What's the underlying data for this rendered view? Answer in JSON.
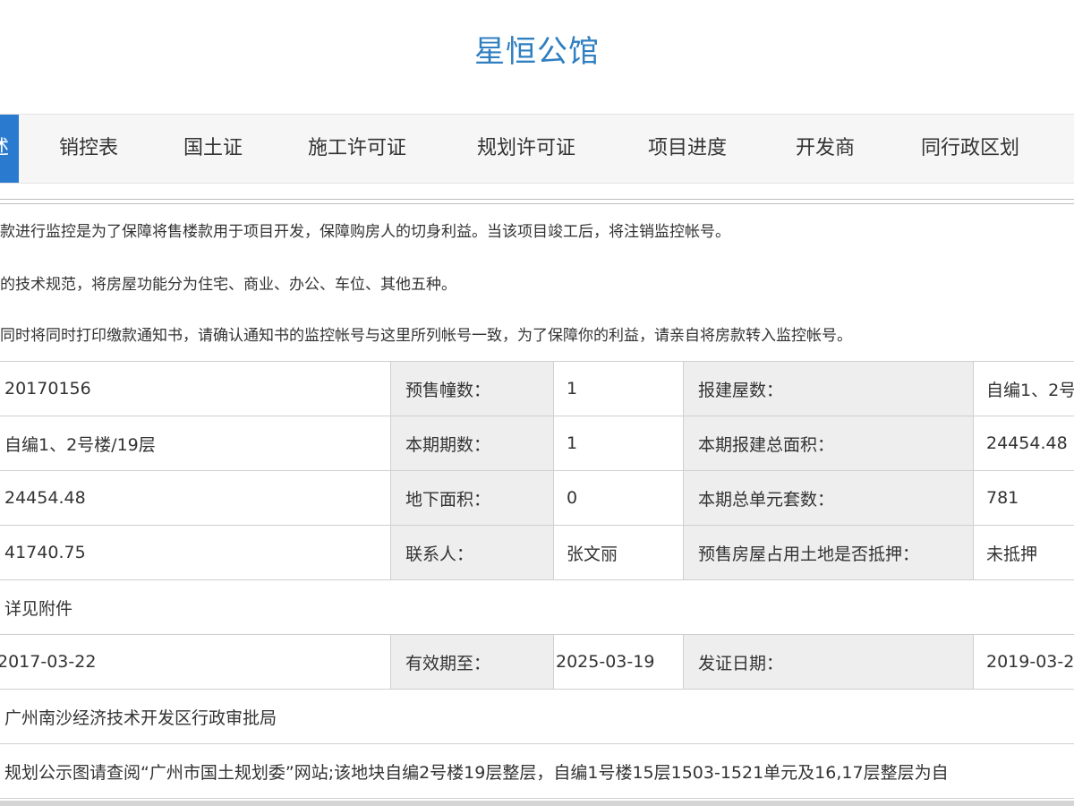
{
  "page_title": "星恒公馆",
  "tabs": {
    "active_partial": "述",
    "items": [
      "销控表",
      "国土证",
      "施工许可证",
      "规划许可证",
      "项目进度",
      "开发商",
      "同行政区划"
    ]
  },
  "notices": [
    "款进行监控是为了保障将售楼款用于项目开发，保障购房人的切身利益。当该项目竣工后，将注销监控帐号。",
    "的技术规范，将房屋功能分为住宅、商业、办公、车位、其他五种。",
    "同时将同时打印缴款通知书，请确认通知书的监控帐号与这里所列帐号一致，为了保障你的利益，请亲自将房款转入监控帐号。"
  ],
  "table": {
    "rows": [
      {
        "v1": "20170156",
        "l2": "预售幢数：",
        "v2": "1",
        "l3": "报建屋数：",
        "v3": "自编1、2号"
      },
      {
        "v1": "自编1、2号楼/19层",
        "l2": "本期期数：",
        "v2": "1",
        "l3": "本期报建总面积：",
        "v3": "24454.48"
      },
      {
        "v1": "24454.48",
        "l2": "地下面积：",
        "v2": "0",
        "l3": "本期总单元套数：",
        "v3": "781"
      },
      {
        "v1": "41740.75",
        "l2": "联系人：",
        "v2": "张文丽",
        "l3": "预售房屋占用土地是否抵押：",
        "v3": "未抵押"
      }
    ],
    "attachment": "详见附件",
    "date_row": {
      "v1": "2017-03-22",
      "l2": "有效期至：",
      "v2": "2025-03-19",
      "l3": "发证日期：",
      "v3": "2019-03-2"
    },
    "authority": "广州南沙经济技术开发区行政审批局",
    "remark": "规划公示图请查阅“广州市国土规划委”网站;该地块自编2号楼19层整层，自编1号楼15层1503-1521单元及16,17层整层为自"
  },
  "colors": {
    "accent": "#2a7bd0",
    "title": "#2f7fc1",
    "label_bg": "#eeeeee"
  }
}
